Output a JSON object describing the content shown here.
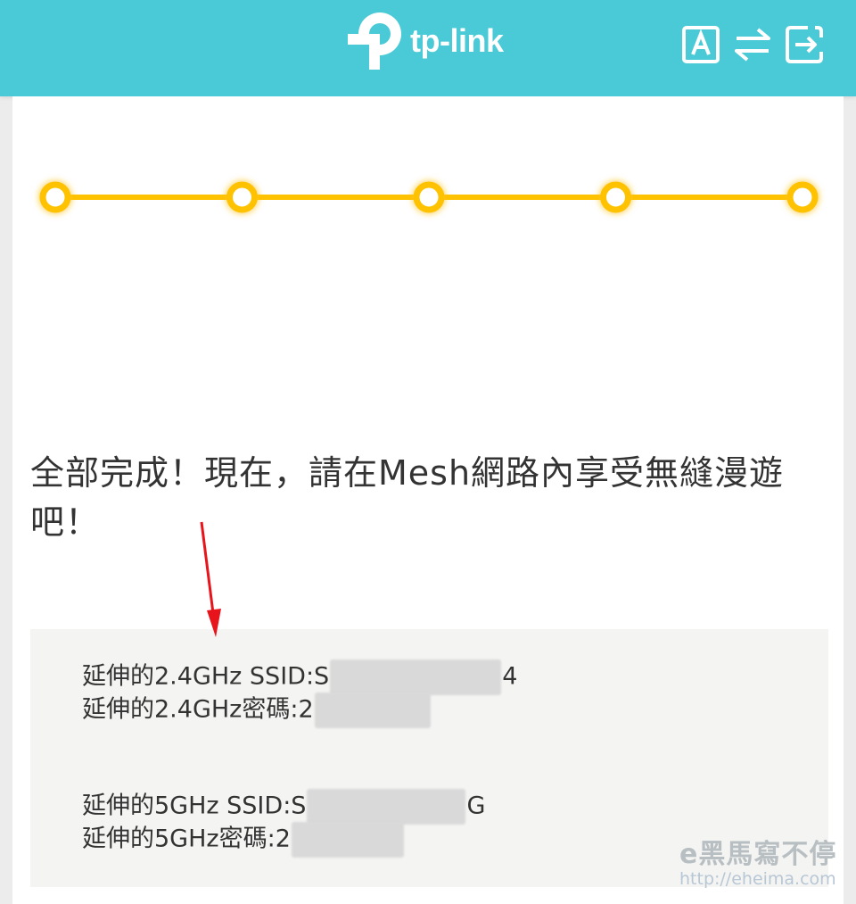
{
  "header": {
    "brand": "tp-link",
    "icons": [
      "language-icon",
      "switch-mode-icon",
      "logout-icon"
    ]
  },
  "progress": {
    "steps_total": 5,
    "steps_completed": 5,
    "color": "#ffc200"
  },
  "main": {
    "headline": "全部完成！現在，請在Mesh網路內享受無縫漫遊吧！",
    "info": {
      "ssid24_label": "延伸的2.4GHz SSID:",
      "ssid24_prefix": "S",
      "ssid24_suffix": "4",
      "pwd24_label": "延伸的2.4GHz密碼:",
      "pwd24_prefix": "2",
      "ssid5_label": "延伸的5GHz SSID:",
      "ssid5_prefix": "S",
      "ssid5_suffix": "G",
      "pwd5_label": "延伸的5GHz密碼:",
      "pwd5_prefix": "2"
    }
  },
  "watermark": {
    "title": "e黑馬寫不停",
    "url": "http://eheima.com"
  },
  "colors": {
    "header_bg": "#4ac9d6",
    "accent": "#ffc200",
    "annotation": "#e8141b"
  }
}
